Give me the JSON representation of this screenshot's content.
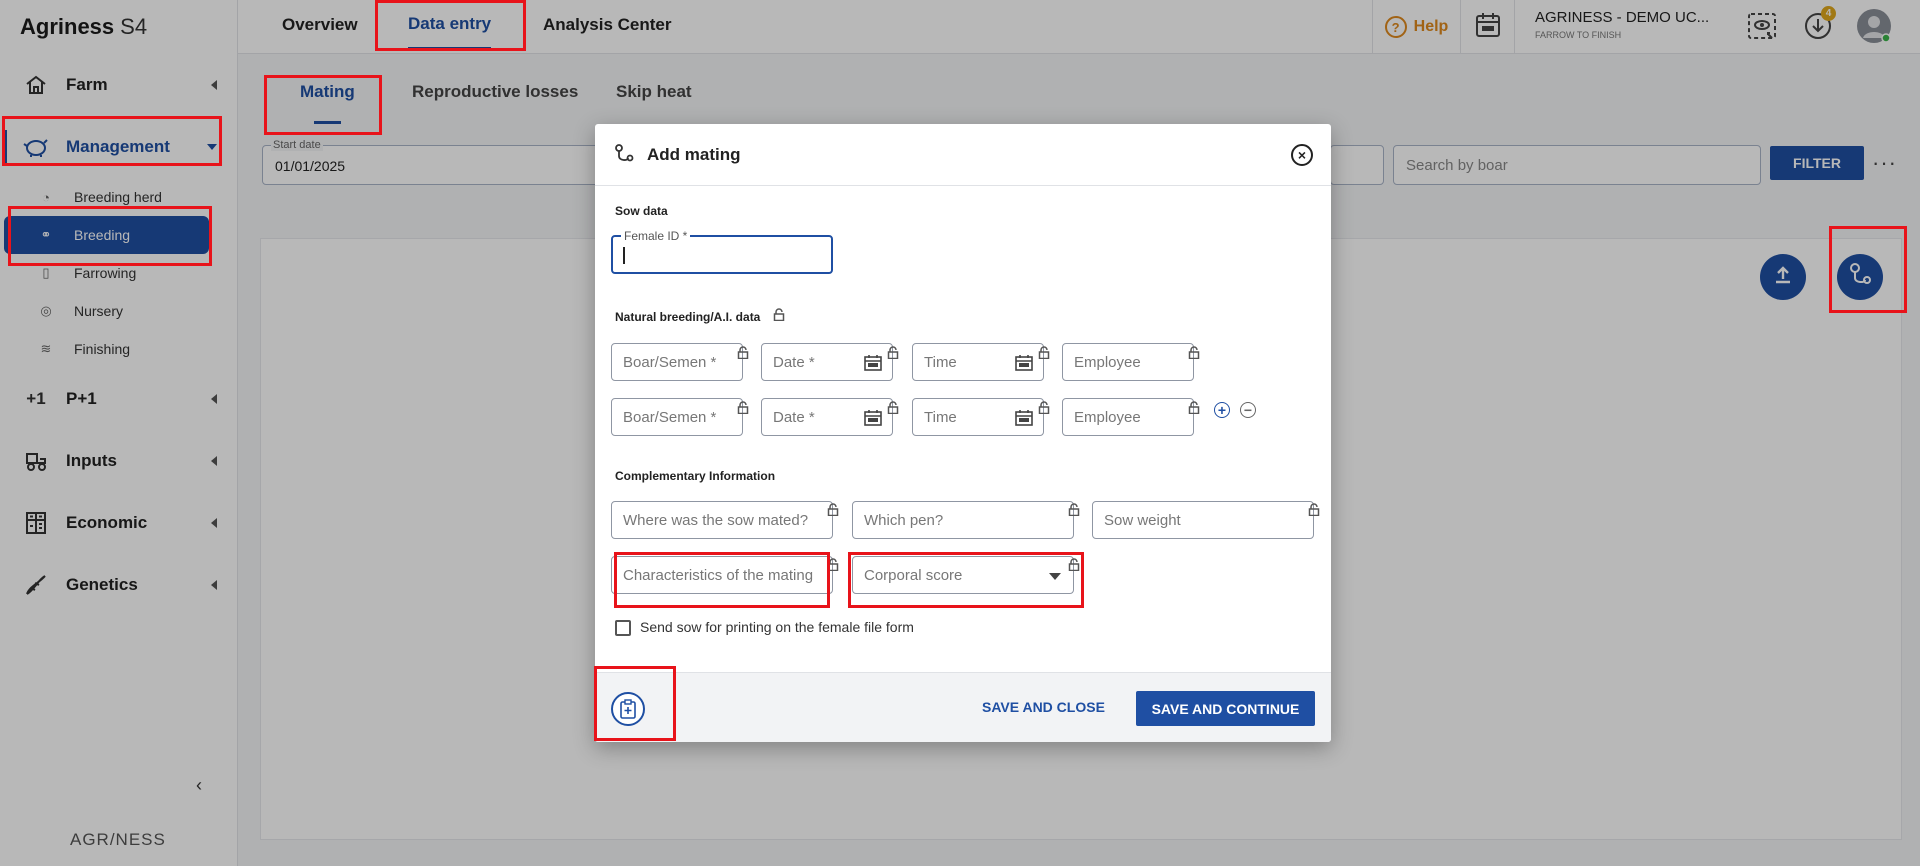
{
  "app": {
    "brand_name": "Agriness",
    "brand_suffix": "S4",
    "footer_logo": "AGR/NESS"
  },
  "sidebar": {
    "groups": [
      {
        "label": "Farm",
        "icon": "house-icon"
      },
      {
        "label": "Management",
        "icon": "pig-icon"
      },
      {
        "label": "P+1",
        "icon": "plus-one-icon"
      },
      {
        "label": "Inputs",
        "icon": "tractor-icon"
      },
      {
        "label": "Economic",
        "icon": "calculator-icon"
      },
      {
        "label": "Genetics",
        "icon": "dna-icon"
      }
    ],
    "management_items": [
      {
        "label": "Breeding herd",
        "icon": "pig-icon"
      },
      {
        "label": "Breeding",
        "icon": "mating-icon"
      },
      {
        "label": "Farrowing",
        "icon": "bottle-icon"
      },
      {
        "label": "Nursery",
        "icon": "piglet-icon"
      },
      {
        "label": "Finishing",
        "icon": "feeder-icon"
      }
    ],
    "collapse_glyph": "‹"
  },
  "topbar": {
    "tabs": [
      "Overview",
      "Data entry",
      "Analysis Center"
    ],
    "active_tab": "Data entry",
    "help_label": "Help",
    "farm_name": "AGRINESS - DEMO UC...",
    "farm_type": "FARROW TO FINISH",
    "download_badge": "4"
  },
  "main": {
    "subtabs": [
      "Mating",
      "Reproductive losses",
      "Skip heat"
    ],
    "active_subtab": "Mating",
    "start_date_label": "Start date",
    "start_date_value": "01/01/2025",
    "search_boar_placeholder": "Search by boar",
    "filter_label": "FILTER",
    "more_glyph": "···"
  },
  "modal": {
    "title": "Add mating",
    "sow_data_title": "Sow data",
    "female_id_label": "Female ID *",
    "natural_breeding_title": "Natural breeding/A.I. data",
    "breeding_rows": [
      {
        "boar": "Boar/Semen *",
        "date": "Date *",
        "time": "Time",
        "employee": "Employee"
      },
      {
        "boar": "Boar/Semen *",
        "date": "Date *",
        "time": "Time",
        "employee": "Employee"
      }
    ],
    "complementary_title": "Complementary Information",
    "where_mated_placeholder": "Where was the sow mated?",
    "which_pen_placeholder": "Which pen?",
    "sow_weight_placeholder": "Sow weight",
    "characteristics_placeholder": "Characteristics of the mating",
    "corporal_score_placeholder": "Corporal score",
    "print_checkbox_label": "Send sow for printing on the female file form",
    "save_close_label": "SAVE AND CLOSE",
    "save_continue_label": "SAVE AND CONTINUE",
    "add_glyph": "+",
    "remove_glyph": "−"
  },
  "colors": {
    "primary": "#1f4fa3",
    "help_orange": "#e08a1e",
    "annotation_red": "#e8131a"
  }
}
